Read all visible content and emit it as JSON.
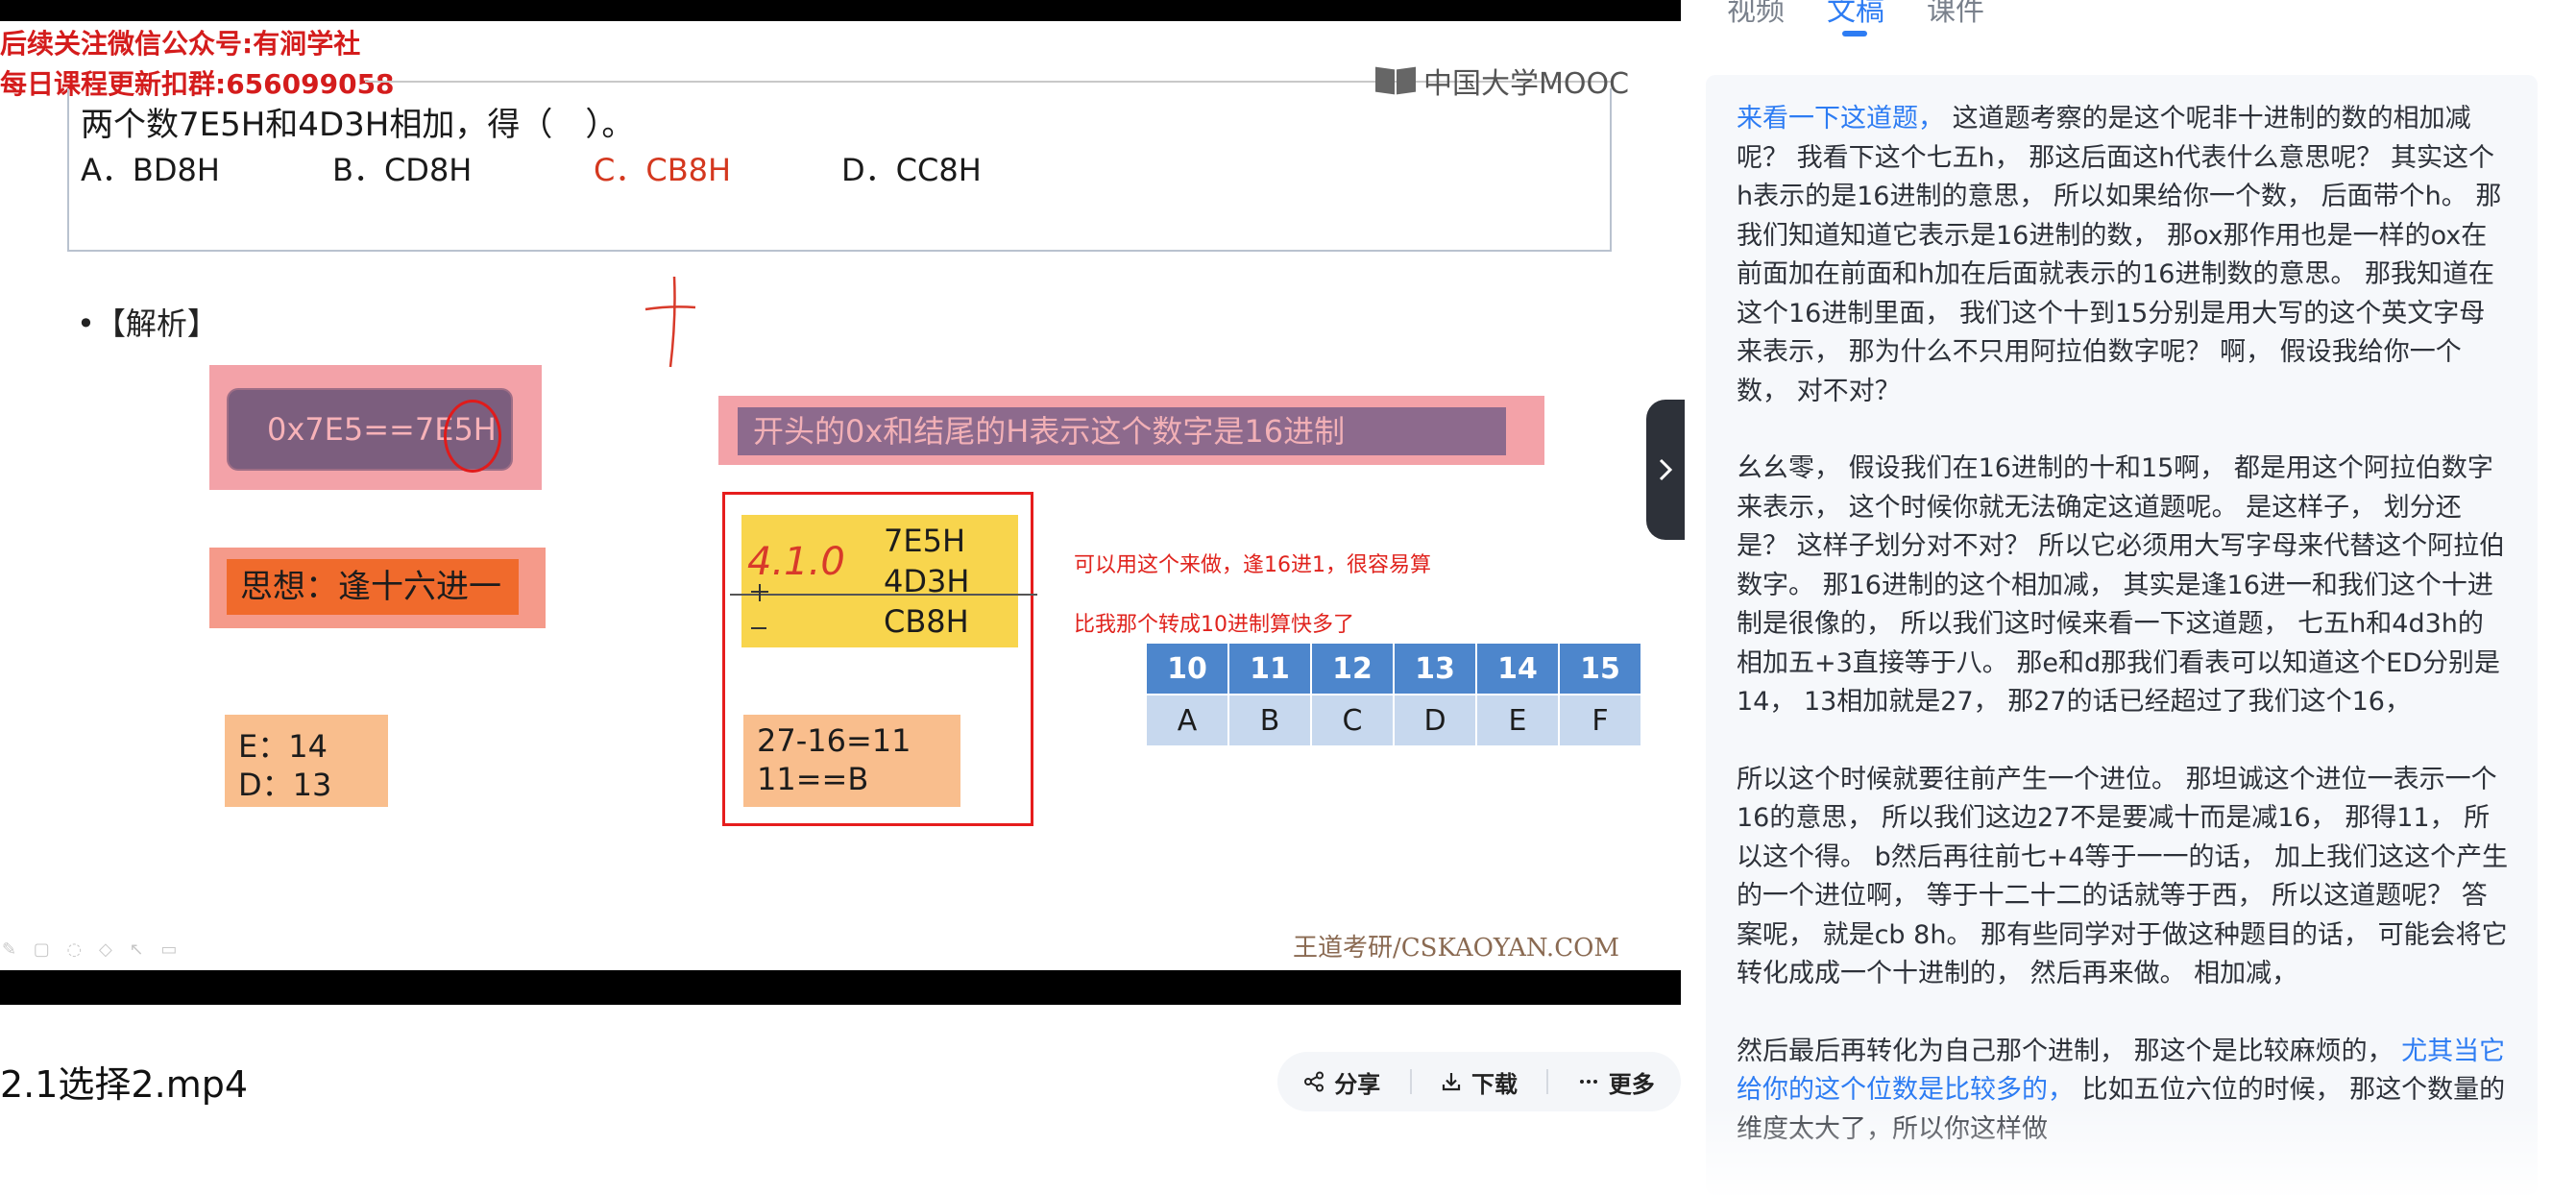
{
  "video": {
    "watermark_line1": "后续关注微信公众号:有涧学社",
    "watermark_line2": "每日课程更新扣群:656099058",
    "mooc_logo": "中国大学MOOC",
    "question": "两个数7E5H和4D3H相加，得（　）。",
    "options": [
      "A．BD8H",
      "B．CD8H",
      "C．CB8H",
      "D．CC8H"
    ],
    "analysis_label": "•【解析】",
    "box1": "0x7E5==7E5H",
    "box2": "开头的0x和结尾的H表示这个数字是16进制",
    "box3": "思想：逢十六进一",
    "calc": [
      "7E5H",
      "4D3H",
      "CB8H"
    ],
    "ed": [
      "E：14",
      "D：13"
    ],
    "carry": [
      "27-16=11",
      "11==B"
    ],
    "note1": "可以用这个来做，逢16进1，很容易算",
    "note2": "比我那个转成10进制算快多了",
    "hex_table": {
      "headers": [
        "10",
        "11",
        "12",
        "13",
        "14",
        "15"
      ],
      "values": [
        "A",
        "B",
        "C",
        "D",
        "E",
        "F"
      ]
    },
    "site_watermark": "王道考研/CSKAOYAN.COM",
    "hand_calc": "4.1.0"
  },
  "file_title": "2.1选择2.mp4",
  "actions": {
    "share": "分享",
    "download": "下载",
    "more": "更多"
  },
  "tabs": [
    "视频",
    "文稿",
    "课件"
  ],
  "transcript": {
    "p1_highlight": "来看一下这道题，",
    "p1_rest": " 这道题考察的是这个呢非十进制的数的相加减呢？ 我看下这个七五h， 那这后面这h代表什么意思呢？ 其实这个h表示的是16进制的意思， 所以如果给你一个数， 后面带个h。 那我们知道知道它表示是16进制的数， 那ox那作用也是一样的ox在前面加在前面和h加在后面就表示的16进制数的意思。 那我知道在这个16进制里面， 我们这个十到15分别是用大写的这个英文字母来表示， 那为什么不只用阿拉伯数字呢？ 啊， 假设我给你一个数， 对不对？",
    "p2": "幺幺零， 假设我们在16进制的十和15啊， 都是用这个阿拉伯数字来表示， 这个时候你就无法确定这道题呢。 是这样子， 划分还是？ 这样子划分对不对？ 所以它必须用大写字母来代替这个阿拉伯数字。 那16进制的这个相加减， 其实是逢16进一和我们这个十进制是很像的， 所以我们这时候来看一下这道题， 七五h和4d3h的相加五+3直接等于八。 那e和d那我们看表可以知道这个ED分别是14， 13相加就是27， 那27的话已经超过了我们这个16，",
    "p3": "所以这个时候就要往前产生一个进位。 那坦诚这个进位一表示一个16的意思， 所以我们这边27不是要减十而是减16， 那得11， 所以这个得。 b然后再往前七+4等于一一的话， 加上我们这这个产生的一个进位啊， 等于十二十二的话就等于西， 所以这道题呢？ 答案呢， 就是cb 8h。 那有些同学对于做这种题目的话， 可能会将它转化成成一个十进制的， 然后再来做。 相加减，",
    "p4_start": "然后最后再转化为自己那个进制， 那这个是比较麻烦的， ",
    "p4_highlight": "尤其当它给你的这个位数是比较多的，",
    "p4_rest": " 比如五位六位的时候， 那这个数量的维度太大了，所以你这样做"
  }
}
